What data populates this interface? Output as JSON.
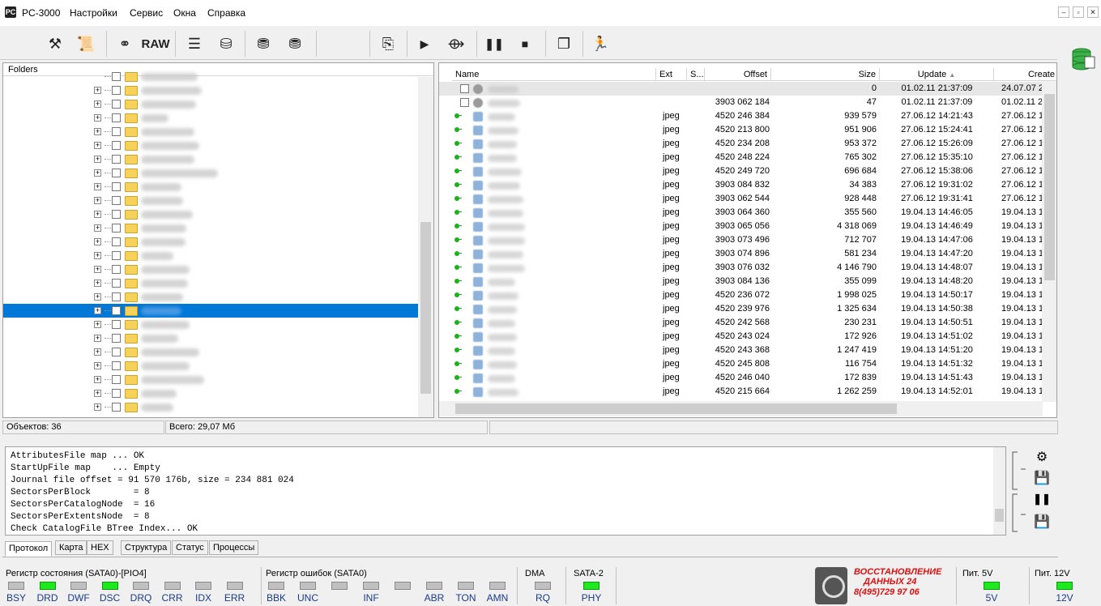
{
  "app": {
    "title": "PC-3000",
    "logo": "PC"
  },
  "menu": [
    "Настройки",
    "Сервис",
    "Окна",
    "Справка"
  ],
  "window_controls": [
    "–",
    "▫",
    "✕"
  ],
  "toolbar": {
    "raw_label": "RAW",
    "icons": [
      "tools-icon",
      "scroll-icon",
      "binoculars-icon",
      "raw-button",
      "hdd-stack-icon",
      "disk-icon",
      "db-list-icon",
      "db-network-icon",
      "export-icon",
      "play-icon",
      "network-share-icon",
      "pause-icon",
      "stop-icon",
      "copy-icon",
      "exit-icon"
    ]
  },
  "left_pane": {
    "header": "Folders",
    "rows": 18
  },
  "right_pane": {
    "columns": [
      "Name",
      "Ext",
      "S...",
      "Offset",
      "Size",
      "Update",
      "Create"
    ],
    "sort_indicator": "▲",
    "rows": [
      {
        "ext": "",
        "offset": "",
        "size": "0",
        "update": "01.02.11 21:37:09",
        "create": "24.07.07 2",
        "grey": true,
        "type": "folder"
      },
      {
        "ext": "",
        "offset": "3903 062 184",
        "size": "47",
        "update": "01.02.11 21:37:09",
        "create": "01.02.11 2",
        "type": "folder"
      },
      {
        "ext": "jpeg",
        "offset": "4520 246 384",
        "size": "939 579",
        "update": "27.06.12 14:21:43",
        "create": "27.06.12 1"
      },
      {
        "ext": "jpeg",
        "offset": "4520 213 800",
        "size": "951 906",
        "update": "27.06.12 15:24:41",
        "create": "27.06.12 1"
      },
      {
        "ext": "jpeg",
        "offset": "4520 234 208",
        "size": "953 372",
        "update": "27.06.12 15:26:09",
        "create": "27.06.12 1"
      },
      {
        "ext": "jpeg",
        "offset": "4520 248 224",
        "size": "765 302",
        "update": "27.06.12 15:35:10",
        "create": "27.06.12 1"
      },
      {
        "ext": "jpeg",
        "offset": "4520 249 720",
        "size": "696 684",
        "update": "27.06.12 15:38:06",
        "create": "27.06.12 1"
      },
      {
        "ext": "jpeg",
        "offset": "3903 084 832",
        "size": "34 383",
        "update": "27.06.12 19:31:02",
        "create": "27.06.12 1"
      },
      {
        "ext": "jpeg",
        "offset": "3903 062 544",
        "size": "928 448",
        "update": "27.06.12 19:31:41",
        "create": "27.06.12 1"
      },
      {
        "ext": "jpeg",
        "offset": "3903 064 360",
        "size": "355 560",
        "update": "19.04.13 14:46:05",
        "create": "19.04.13 1"
      },
      {
        "ext": "jpeg",
        "offset": "3903 065 056",
        "size": "4 318 069",
        "update": "19.04.13 14:46:49",
        "create": "19.04.13 1"
      },
      {
        "ext": "jpeg",
        "offset": "3903 073 496",
        "size": "712 707",
        "update": "19.04.13 14:47:06",
        "create": "19.04.13 1"
      },
      {
        "ext": "jpeg",
        "offset": "3903 074 896",
        "size": "581 234",
        "update": "19.04.13 14:47:20",
        "create": "19.04.13 1"
      },
      {
        "ext": "jpeg",
        "offset": "3903 076 032",
        "size": "4 146 790",
        "update": "19.04.13 14:48:07",
        "create": "19.04.13 1"
      },
      {
        "ext": "jpeg",
        "offset": "3903 084 136",
        "size": "355 099",
        "update": "19.04.13 14:48:20",
        "create": "19.04.13 1"
      },
      {
        "ext": "jpeg",
        "offset": "4520 236 072",
        "size": "1 998 025",
        "update": "19.04.13 14:50:17",
        "create": "19.04.13 1"
      },
      {
        "ext": "jpeg",
        "offset": "4520 239 976",
        "size": "1 325 634",
        "update": "19.04.13 14:50:38",
        "create": "19.04.13 1"
      },
      {
        "ext": "jpeg",
        "offset": "4520 242 568",
        "size": "230 231",
        "update": "19.04.13 14:50:51",
        "create": "19.04.13 1"
      },
      {
        "ext": "jpeg",
        "offset": "4520 243 024",
        "size": "172 926",
        "update": "19.04.13 14:51:02",
        "create": "19.04.13 1"
      },
      {
        "ext": "jpeg",
        "offset": "4520 243 368",
        "size": "1 247 419",
        "update": "19.04.13 14:51:20",
        "create": "19.04.13 1"
      },
      {
        "ext": "jpeg",
        "offset": "4520 245 808",
        "size": "116 754",
        "update": "19.04.13 14:51:32",
        "create": "19.04.13 1"
      },
      {
        "ext": "jpeg",
        "offset": "4520 246 040",
        "size": "172 839",
        "update": "19.04.13 14:51:43",
        "create": "19.04.13 1"
      },
      {
        "ext": "jpeg",
        "offset": "4520 215 664",
        "size": "1 262 259",
        "update": "19.04.13 14:52:01",
        "create": "19.04.13 1"
      }
    ]
  },
  "status": {
    "objects": "Объектов: 36",
    "total": "Всего: 29,07 Мб"
  },
  "log": [
    "AttributesFile map ... OK",
    "StartUpFile map    ... Empty",
    "Journal file offset = 91 570 176b, size = 234 881 024",
    "SectorsPerBlock        = 8",
    "SectorsPerCatalogNode  = 16",
    "SectorsPerExtentsNode  = 8",
    "Check CatalogFile BTree Index... OK"
  ],
  "tabs": [
    "Протокол",
    "Карта",
    "HEX",
    "Структура",
    "Статус",
    "Процессы"
  ],
  "registers": {
    "state": {
      "title": "Регистр состояния (SATA0)-[PIO4]",
      "leds": [
        {
          "label": "BSY",
          "on": false
        },
        {
          "label": "DRD",
          "on": true
        },
        {
          "label": "DWF",
          "on": false
        },
        {
          "label": "DSC",
          "on": true
        },
        {
          "label": "DRQ",
          "on": false
        },
        {
          "label": "CRR",
          "on": false
        },
        {
          "label": "IDX",
          "on": false
        },
        {
          "label": "ERR",
          "on": false
        }
      ]
    },
    "error": {
      "title": "Регистр ошибок  (SATA0)",
      "leds": [
        {
          "label": "BBK",
          "on": false
        },
        {
          "label": "UNC",
          "on": false
        },
        {
          "label": "",
          "on": false
        },
        {
          "label": "INF",
          "on": false
        },
        {
          "label": "",
          "on": false
        },
        {
          "label": "ABR",
          "on": false
        },
        {
          "label": "TON",
          "on": false
        },
        {
          "label": "AMN",
          "on": false
        }
      ]
    },
    "dma": {
      "title": "DMA",
      "label": "RQ",
      "on": false
    },
    "sata": {
      "title": "SATA-2",
      "label": "PHY",
      "on": true
    },
    "pit5": {
      "title": "Пит. 5V",
      "label": "5V",
      "on": true
    },
    "pit12": {
      "title": "Пит. 12V",
      "label": "12V",
      "on": true
    }
  },
  "brand": {
    "line1": "ВОССТАНОВЛЕНИЕ",
    "line2": "ДАННЫХ  24",
    "line3": "8(495)729 97 06"
  },
  "colors": {
    "selection": "#0078d7",
    "led_on": "#1ee81e",
    "led_off": "#c0c0c0",
    "brand_red": "#e01010"
  }
}
